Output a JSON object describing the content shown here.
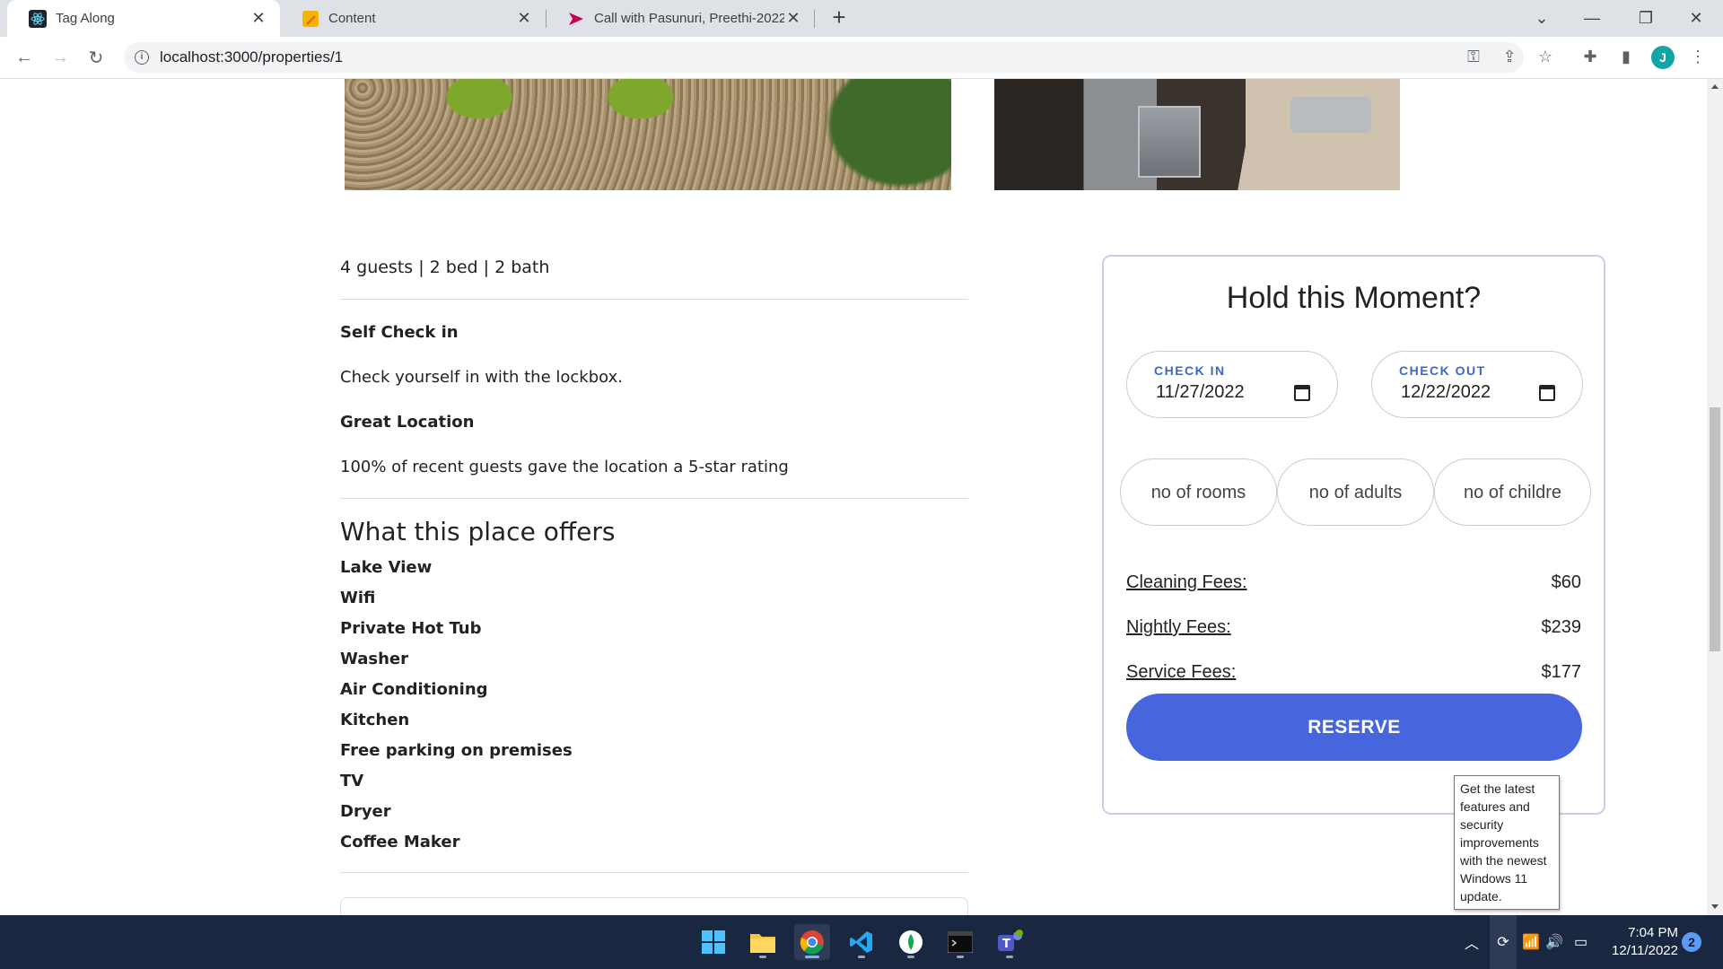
{
  "browser": {
    "tabs": [
      {
        "title": "Tag Along",
        "active": true,
        "icon": "react-icon"
      },
      {
        "title": "Content",
        "active": false,
        "icon": "notes-icon"
      },
      {
        "title": "Call with Pasunuri, Preethi-20221",
        "active": false,
        "icon": "stream-icon"
      }
    ],
    "url": "localhost:3000/properties/1",
    "profile_initial": "J"
  },
  "listing": {
    "stats": "4 guests | 2 bed | 2 bath",
    "highlights": [
      {
        "title": "Self Check in",
        "text": "Check yourself in with the lockbox."
      },
      {
        "title": "Great Location",
        "text": "100% of recent guests gave the location a 5-star rating"
      }
    ],
    "offers_title": "What this place offers",
    "amenities": [
      "Lake View",
      "Wifi",
      "Private Hot Tub",
      "Washer",
      "Air Conditioning",
      "Kitchen",
      "Free parking on premises",
      "TV",
      "Dryer",
      "Coffee Maker"
    ]
  },
  "booking": {
    "title": "Hold this Moment?",
    "check_in_label": "CHECK IN",
    "check_in_value": "11/27/2022",
    "check_out_label": "CHECK OUT",
    "check_out_value": "12/22/2022",
    "rooms_placeholder": "no of rooms",
    "adults_placeholder": "no of adults",
    "children_placeholder": "no of childre",
    "fees": [
      {
        "label": "Cleaning Fees:",
        "value": "$60"
      },
      {
        "label": "Nightly Fees:",
        "value": "$239"
      },
      {
        "label": "Service Fees:",
        "value": "$177"
      }
    ],
    "reserve_label": "RESERVE",
    "accent_color": "#4765dd"
  },
  "tooltip": {
    "text": "Get the latest features and security improvements with the newest Windows 11 update."
  },
  "taskbar": {
    "time": "7:04 PM",
    "date": "12/11/2022",
    "notification_count": "2"
  }
}
